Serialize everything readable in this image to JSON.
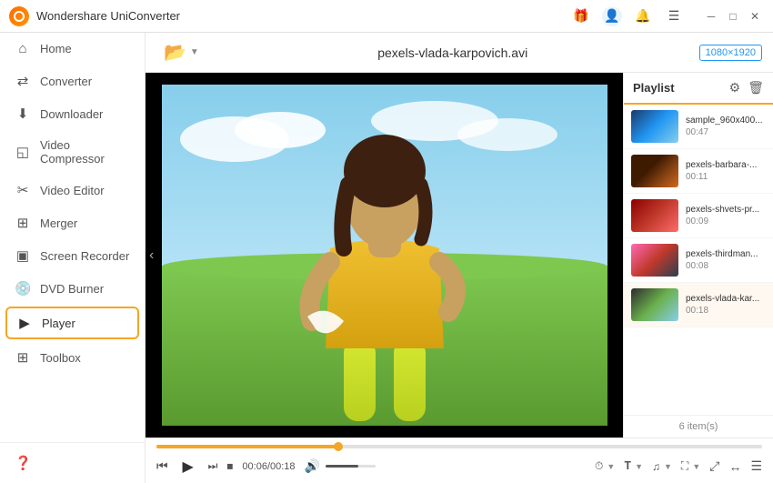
{
  "app": {
    "title": "Wondershare UniConverter",
    "logo_alt": "app-logo"
  },
  "titlebar": {
    "controls": [
      "minimize",
      "maximize",
      "close"
    ]
  },
  "sidebar": {
    "items": [
      {
        "id": "home",
        "label": "Home",
        "icon": "⌂"
      },
      {
        "id": "converter",
        "label": "Converter",
        "icon": "⇄"
      },
      {
        "id": "downloader",
        "label": "Downloader",
        "icon": "↓"
      },
      {
        "id": "video-compressor",
        "label": "Video Compressor",
        "icon": "◫"
      },
      {
        "id": "video-editor",
        "label": "Video Editor",
        "icon": "✂"
      },
      {
        "id": "merger",
        "label": "Merger",
        "icon": "⊞"
      },
      {
        "id": "screen-recorder",
        "label": "Screen Recorder",
        "icon": "▣"
      },
      {
        "id": "dvd-burner",
        "label": "DVD Burner",
        "icon": "⊙"
      },
      {
        "id": "player",
        "label": "Player",
        "icon": "▶",
        "active": true
      },
      {
        "id": "toolbox",
        "label": "Toolbox",
        "icon": "⊞"
      }
    ],
    "bottom": [
      {
        "id": "help",
        "icon": "?"
      },
      {
        "id": "notifications",
        "icon": "🔔"
      },
      {
        "id": "settings",
        "icon": "☺"
      }
    ]
  },
  "toolbar": {
    "add_btn_icon": "📁",
    "add_btn_label": "",
    "file_name": "pexels-vlada-karpovich.avi",
    "resolution": "1080×1920"
  },
  "playlist": {
    "title": "Playlist",
    "items": [
      {
        "name": "sample_960x400...",
        "duration": "00:47",
        "thumb_class": "thumb-1"
      },
      {
        "name": "pexels-barbara-...",
        "duration": "00:11",
        "thumb_class": "thumb-2"
      },
      {
        "name": "pexels-shvets-pr...",
        "duration": "00:09",
        "thumb_class": "thumb-3"
      },
      {
        "name": "pexels-thirdman...",
        "duration": "00:08",
        "thumb_class": "thumb-4"
      },
      {
        "name": "pexels-vlada-kar...",
        "duration": "00:18",
        "thumb_class": "thumb-5"
      }
    ],
    "count": "6 item(s)"
  },
  "player": {
    "current_time": "00:06",
    "total_time": "00:18",
    "time_display": "00:06/00:18",
    "progress_percent": 33
  },
  "controls": {
    "playback_speed_label": "",
    "subtitle_label": "",
    "audio_label": "",
    "screen_label": "",
    "playlist_label": ""
  }
}
